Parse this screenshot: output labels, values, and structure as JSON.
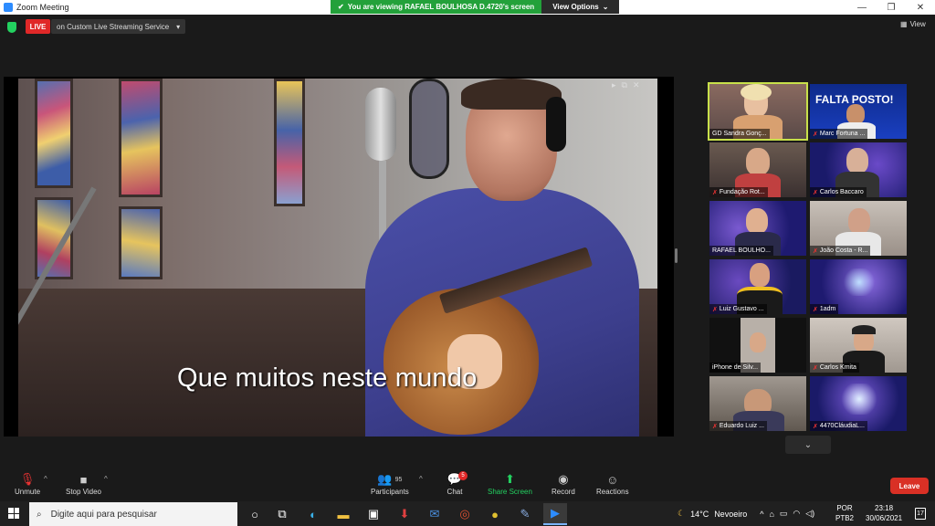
{
  "window": {
    "title": "Zoom Meeting",
    "minimize": "—",
    "maximize": "❐",
    "close": "✕"
  },
  "share_banner": {
    "message": "You are viewing RAFAEL BOULHOSA D.4720's screen",
    "options": "View Options",
    "options_caret": "⌄"
  },
  "topbar": {
    "live_label": "LIVE",
    "stream_label": "on Custom Live Streaming Service",
    "stream_caret": "▾",
    "view_label": "View"
  },
  "video": {
    "subtitle": "Que muitos neste mundo"
  },
  "gallery": {
    "participants": [
      {
        "name": "GD Sandra Gonç...",
        "muted": false,
        "active": true
      },
      {
        "name": "Marc Fortuna ...",
        "muted": true
      },
      {
        "name": "Fundação Rot...",
        "muted": true
      },
      {
        "name": "Carlos Baccarо",
        "muted": true
      },
      {
        "name": "RAFAEL BOULHO...",
        "muted": false
      },
      {
        "name": "João Costa - R...",
        "muted": true
      },
      {
        "name": "Luiz Gustavo ...",
        "muted": true
      },
      {
        "name": "1adm",
        "muted": true
      },
      {
        "name": "iPhone de Silv...",
        "muted": false
      },
      {
        "name": "Carlos Kmita",
        "muted": true
      },
      {
        "name": "Eduardo Luiz ...",
        "muted": true
      },
      {
        "name": "4470CláudiaL...",
        "muted": true
      }
    ],
    "banner_text": "FALTA POSTO!"
  },
  "toolbar": {
    "unmute": "Unmute",
    "stop_video": "Stop Video",
    "participants": "Participants",
    "participants_count": "95",
    "chat": "Chat",
    "chat_badge": "5",
    "share_screen": "Share Screen",
    "record": "Record",
    "reactions": "Reactions",
    "leave": "Leave"
  },
  "taskbar": {
    "search_placeholder": "Digite aqui para pesquisar",
    "weather_temp": "14°C",
    "weather_desc": "Nevoeiro",
    "lang_top": "POR",
    "lang_bottom": "PTB2",
    "time": "23:18",
    "date": "30/06/2021",
    "notifications": "17"
  },
  "colors": {
    "live": "#e02828",
    "share_green": "#23a13a",
    "leave": "#d93025",
    "active_speaker": "#c8e04a"
  }
}
